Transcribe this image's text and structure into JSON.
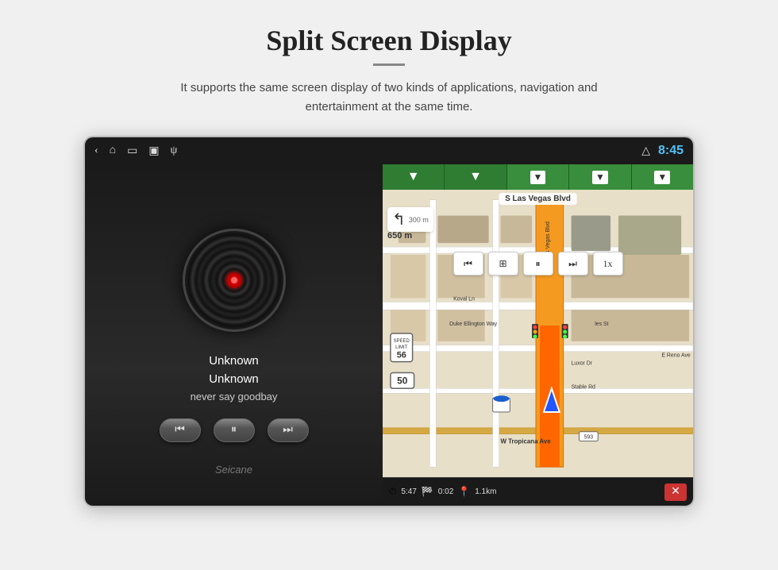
{
  "page": {
    "title": "Split Screen Display",
    "subtitle": "It supports the same screen display of two kinds of applications, navigation and entertainment at the same time.",
    "divider_visible": true
  },
  "status_bar": {
    "time": "8:45",
    "nav_icons": [
      "‹",
      "⌂",
      "▭",
      "▣",
      "ψ"
    ],
    "right_icons": [
      "△"
    ]
  },
  "music_panel": {
    "track_title": "Unknown",
    "track_artist": "Unknown",
    "track_album": "never say goodbay",
    "controls": {
      "prev_label": "⏮",
      "play_label": "⏸",
      "next_label": "⏭"
    }
  },
  "nav_panel": {
    "street_name": "S Las Vegas Blvd",
    "turn_direction": "↰",
    "turn_distance": "300 m",
    "side_distance": "650 m",
    "speed_limit": "56",
    "speed_current": "50",
    "media_controls": [
      "⏮",
      "⏹",
      "⏸",
      "⏭",
      "1x"
    ],
    "bottom_bar": {
      "time1": "5:47",
      "icon1": "⏱",
      "time2": "0:02",
      "icon2": "🏁",
      "distance": "1.1km",
      "icon3": "📍",
      "close": "✕"
    }
  },
  "watermark": "Seicane"
}
